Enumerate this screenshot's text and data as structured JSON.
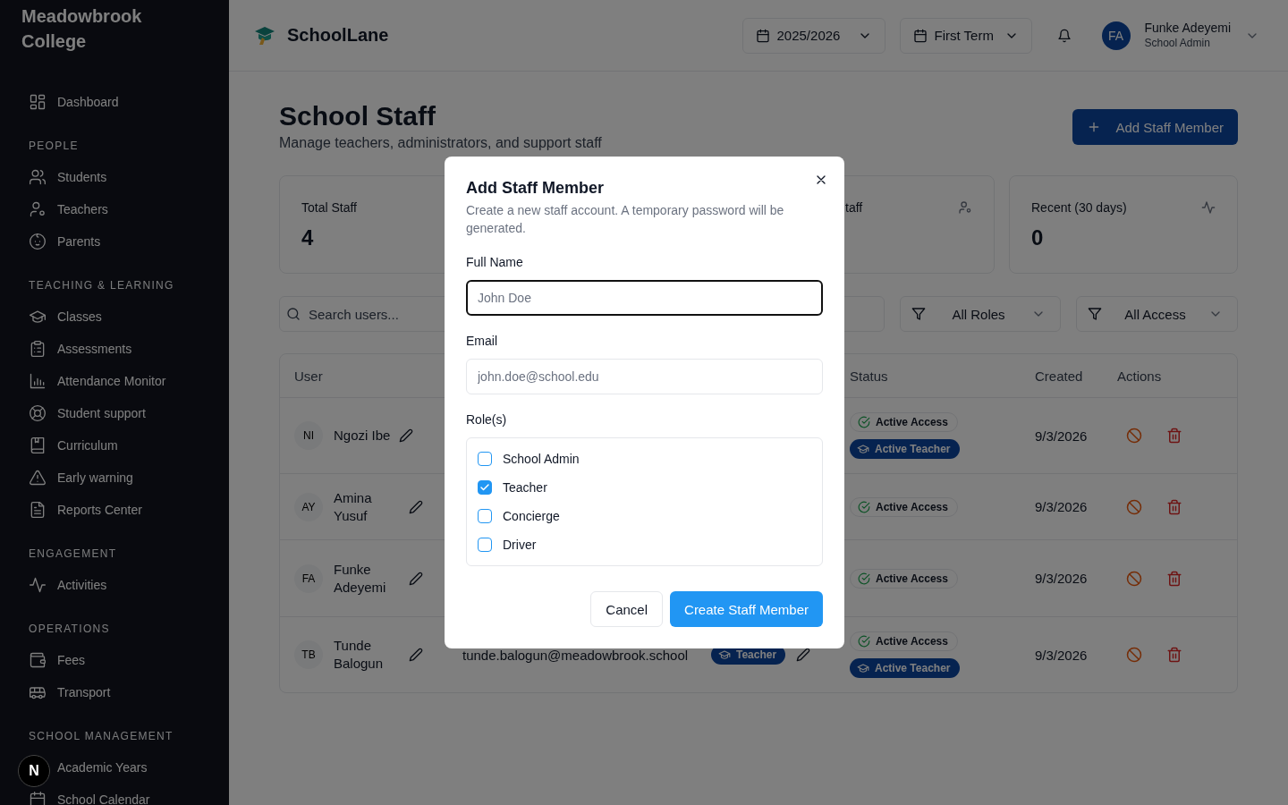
{
  "sidebar": {
    "school_name": "Meadowbrook College",
    "sections": [
      {
        "items": [
          {
            "label": "Dashboard"
          }
        ]
      },
      {
        "title": "PEOPLE",
        "items": [
          {
            "label": "Students"
          },
          {
            "label": "Teachers"
          },
          {
            "label": "Parents"
          }
        ]
      },
      {
        "title": "TEACHING & LEARNING",
        "items": [
          {
            "label": "Classes"
          },
          {
            "label": "Assessments"
          },
          {
            "label": "Attendance Monitor"
          },
          {
            "label": "Student support"
          },
          {
            "label": "Curriculum"
          },
          {
            "label": "Early warning"
          },
          {
            "label": "Reports Center"
          }
        ]
      },
      {
        "title": "ENGAGEMENT",
        "items": [
          {
            "label": "Activities"
          }
        ]
      },
      {
        "title": "OPERATIONS",
        "items": [
          {
            "label": "Fees"
          },
          {
            "label": "Transport"
          }
        ]
      },
      {
        "title": "SCHOOL MANAGEMENT",
        "items": [
          {
            "label": "Academic Years"
          },
          {
            "label": "School Calendar"
          }
        ]
      }
    ]
  },
  "header": {
    "app_name": "SchoolLane",
    "year": "2025/2026",
    "term": "First Term",
    "user": {
      "initials": "FA",
      "name": "Funke Adeyemi",
      "role": "School Admin"
    }
  },
  "page": {
    "title": "School Staff",
    "subtitle": "Manage teachers, administrators, and support staff",
    "add_button": "Add Staff Member",
    "stats": [
      {
        "label": "Total Staff",
        "value": "4",
        "clipped": false
      },
      {
        "label": "taff",
        "clipped": true
      },
      {
        "label": "Recent (30 days)",
        "value": "0",
        "clipped": false
      }
    ],
    "filters": {
      "search_placeholder": "Search users...",
      "role_filter": "All Roles",
      "access_filter": "All Access"
    },
    "table": {
      "columns": [
        {
          "kind": "user",
          "label": "User"
        },
        {
          "kind": "status",
          "label": "Status"
        },
        {
          "kind": "created",
          "label": "Created"
        },
        {
          "kind": "actions",
          "label": "Actions"
        }
      ],
      "rows": [
        {
          "initials": "NI",
          "name": "Ngozi Ibe",
          "status": [
            {
              "kind": "access",
              "label": "Active Access"
            },
            {
              "kind": "teacher",
              "label": "Active Teacher"
            }
          ],
          "created": "9/3/2026"
        },
        {
          "initials": "AY",
          "name": "Amina Yusuf",
          "status": [
            {
              "kind": "access",
              "label": "Active Access"
            }
          ],
          "created": "9/3/2026"
        },
        {
          "initials": "FA",
          "name": "Funke Adeyemi",
          "status": [
            {
              "kind": "access",
              "label": "Active Access"
            }
          ],
          "created": "9/3/2026"
        },
        {
          "initials": "TB",
          "name": "Tunde Balogun",
          "email": "tunde.balogun@meadowbrook.school",
          "roles": [
            "Teacher"
          ],
          "status": [
            {
              "kind": "access",
              "label": "Active Access"
            },
            {
              "kind": "teacher",
              "label": "Active Teacher"
            }
          ],
          "created": "9/3/2026"
        }
      ]
    }
  },
  "dialog": {
    "title": "Add Staff Member",
    "description": "Create a new staff account. A temporary password will be generated.",
    "fields": [
      {
        "kind": "text",
        "label": "Full Name",
        "placeholder": "John Doe",
        "focused": true
      },
      {
        "kind": "text",
        "label": "Email",
        "placeholder": "john.doe@school.edu",
        "focused": false
      },
      {
        "kind": "checklist",
        "label": "Role(s)",
        "options": [
          {
            "label": "School Admin",
            "checked": false
          },
          {
            "label": "Teacher",
            "checked": true
          },
          {
            "label": "Concierge",
            "checked": false
          },
          {
            "label": "Driver",
            "checked": false
          }
        ]
      }
    ],
    "buttons": [
      {
        "kind": "secondary",
        "label": "Cancel"
      },
      {
        "kind": "primary",
        "label": "Create Staff Member"
      }
    ]
  },
  "dev_badge": {
    "letter": "N"
  }
}
